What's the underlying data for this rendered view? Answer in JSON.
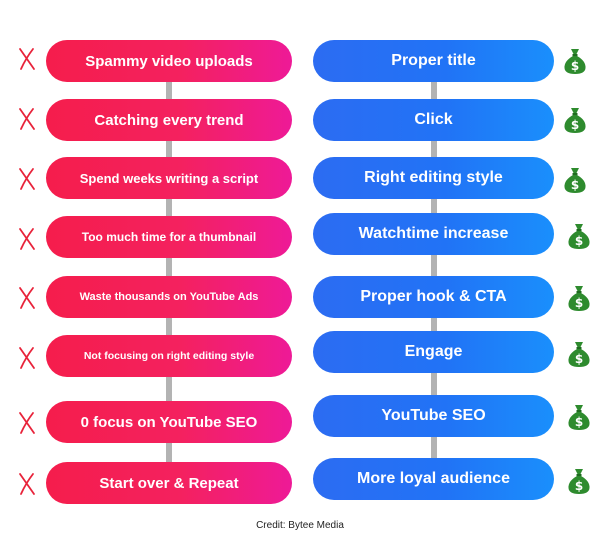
{
  "colors": {
    "bad_start": "#f51d4c",
    "bad_end": "#ee1a97",
    "good_start": "#2c6cf2",
    "good_end": "#1a8ffc",
    "connector": "#b3b3b3",
    "cross": "#e8233a",
    "money": "#2e8b2e"
  },
  "left_column": {
    "icon": "cross-mark-icon",
    "items": [
      "Spammy video uploads",
      "Catching every trend",
      "Spend weeks writing a script",
      "Too much time for a thumbnail",
      "Waste thousands on YouTube Ads",
      "Not focusing on right editing style",
      "0 focus on YouTube SEO",
      "Start over & Repeat"
    ]
  },
  "right_column": {
    "icon": "money-bag-icon",
    "items": [
      "Proper title",
      "Click",
      "Right editing style",
      "Watchtime increase",
      "Proper hook & CTA",
      "Engage",
      "YouTube SEO",
      "More loyal audience"
    ]
  },
  "credit": "Credit: Bytee Media"
}
